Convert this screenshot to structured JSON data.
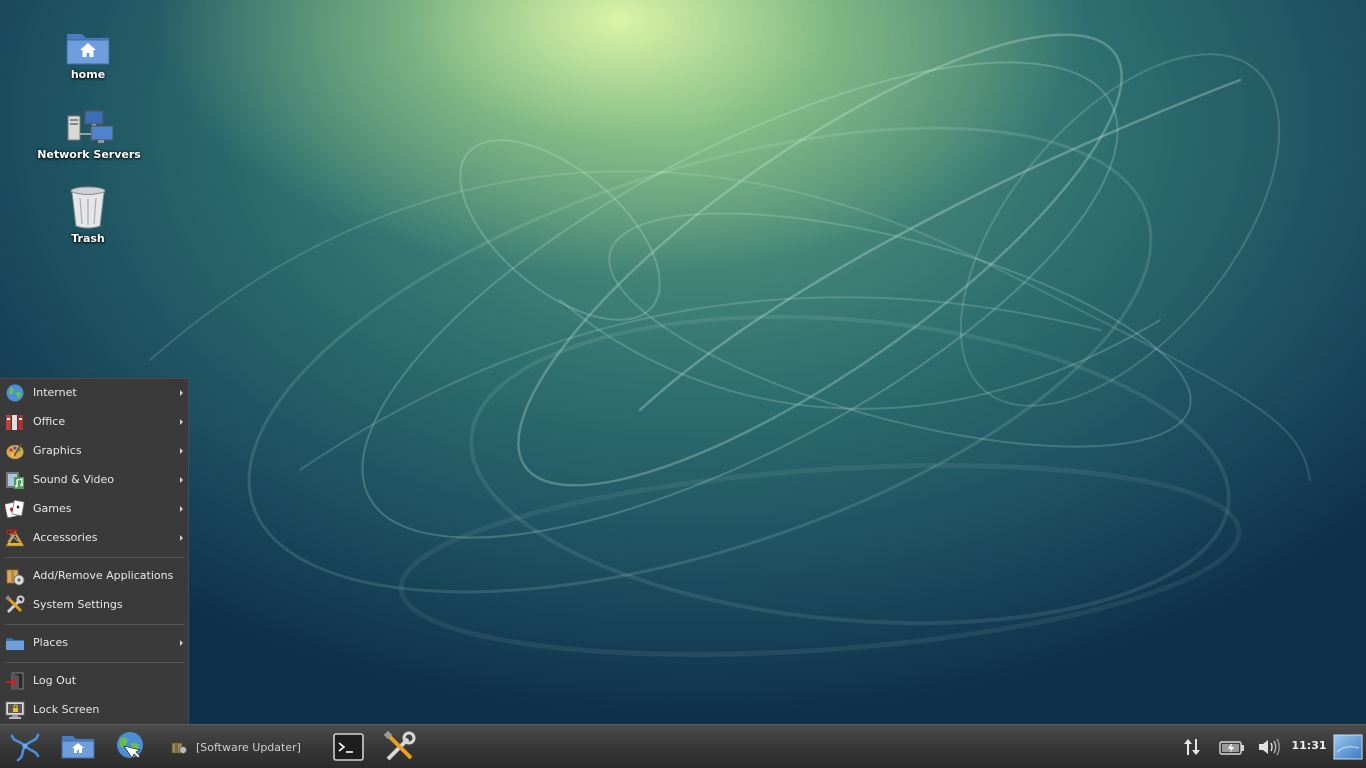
{
  "desktop": {
    "icons": [
      {
        "label": "home",
        "icon": "home-folder-icon"
      },
      {
        "label": "Network Servers",
        "icon": "network-servers-icon"
      },
      {
        "label": "Trash",
        "icon": "trash-icon"
      }
    ]
  },
  "start_menu": {
    "items": [
      {
        "label": "Internet",
        "icon": "globe-icon",
        "submenu": true
      },
      {
        "label": "Office",
        "icon": "office-icon",
        "submenu": true
      },
      {
        "label": "Graphics",
        "icon": "graphics-icon",
        "submenu": true
      },
      {
        "label": "Sound & Video",
        "icon": "media-icon",
        "submenu": true
      },
      {
        "label": "Games",
        "icon": "cards-icon",
        "submenu": true
      },
      {
        "label": "Accessories",
        "icon": "accessories-icon",
        "submenu": true
      },
      {
        "label": "Add/Remove Applications",
        "icon": "package-icon",
        "submenu": false
      },
      {
        "label": "System Settings",
        "icon": "tools-icon",
        "submenu": false
      },
      {
        "label": "Places",
        "icon": "folder-icon",
        "submenu": true
      },
      {
        "label": "Log Out",
        "icon": "logout-icon",
        "submenu": false
      },
      {
        "label": "Lock Screen",
        "icon": "lock-screen-icon",
        "submenu": false
      }
    ]
  },
  "taskbar": {
    "launchers": [
      "app-menu-logo-icon",
      "home-folder-icon",
      "web-browser-icon"
    ],
    "task": {
      "label": "[Software Updater]",
      "icon": "software-updater-icon"
    },
    "quicklaunch": [
      "terminal-icon",
      "settings-tools-icon"
    ],
    "tray": [
      "network-icon",
      "battery-icon",
      "volume-icon",
      "show-desktop-icon"
    ],
    "clock": "11:31"
  },
  "colors": {
    "menu_bg": "#3a3a3a",
    "taskbar_bg": "#363636",
    "wallpaper_highlight": "#d8f5a8",
    "wallpaper_dark": "#0f3049"
  }
}
